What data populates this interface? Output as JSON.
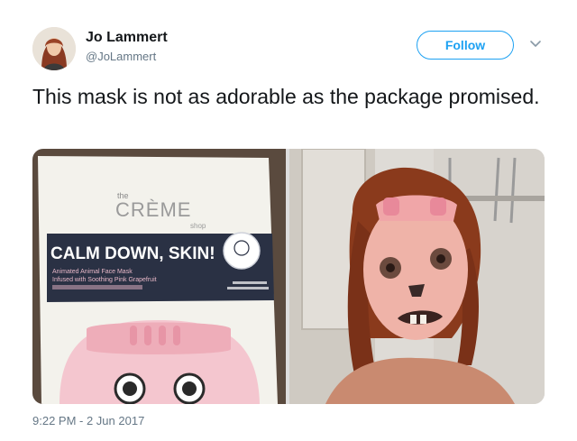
{
  "author": {
    "name": "Jo Lammert",
    "handle": "@JoLammert"
  },
  "follow_label": "Follow",
  "tweet": {
    "text": "This mask is not as adorable as the package promised."
  },
  "media": {
    "package": {
      "brand_the": "the",
      "brand_name": "CRÈME",
      "brand_shop": "shop",
      "headline": "CALM DOWN, SKIN!",
      "line1": "Animated Animal Face Mask",
      "line2": "Infused with Soothing Pink Grapefruit"
    }
  },
  "timestamp": "9:22 PM - 2 Jun 2017",
  "colors": {
    "accent": "#1da1f2",
    "secondary_text": "#657786",
    "primary_text": "#14171a"
  }
}
